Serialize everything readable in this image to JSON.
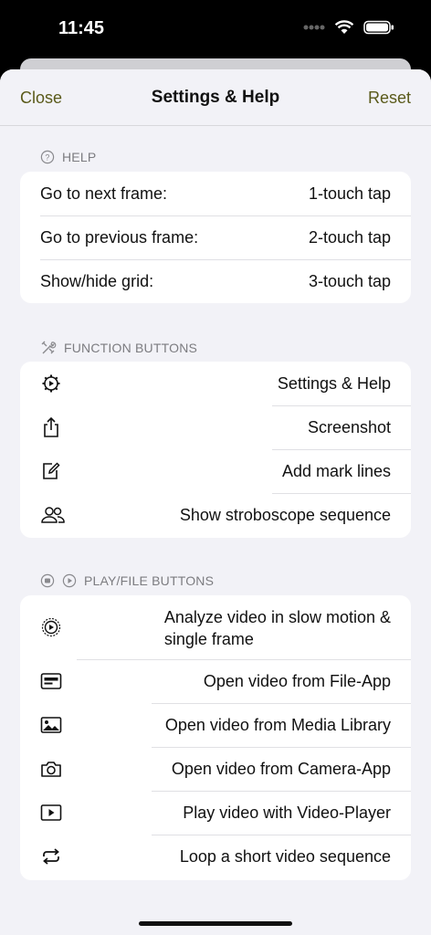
{
  "status": {
    "time": "11:45"
  },
  "nav": {
    "close": "Close",
    "title": "Settings & Help",
    "reset": "Reset"
  },
  "help": {
    "header": "HELP",
    "rows": [
      {
        "action": "Go to next frame:",
        "gesture": "1-touch tap"
      },
      {
        "action": "Go to previous frame:",
        "gesture": "2-touch tap"
      },
      {
        "action": "Show/hide grid:",
        "gesture": "3-touch tap"
      }
    ]
  },
  "function_buttons": {
    "header": "FUNCTION BUTTONS",
    "rows": [
      {
        "icon": "settings-gear-icon",
        "label": "Settings & Help"
      },
      {
        "icon": "share-icon",
        "label": "Screenshot"
      },
      {
        "icon": "edit-icon",
        "label": "Add mark lines"
      },
      {
        "icon": "people-icon",
        "label": "Show stroboscope sequence"
      }
    ]
  },
  "play_file_buttons": {
    "header": "PLAY/FILE BUTTONS",
    "rows": [
      {
        "icon": "play-circle-icon",
        "label_line1": "Analyze video in slow motion &",
        "label_line2": "single frame"
      },
      {
        "icon": "file-card-icon",
        "label": "Open video from File-App"
      },
      {
        "icon": "photo-icon",
        "label": "Open video from Media Library"
      },
      {
        "icon": "camera-icon",
        "label": "Open video from Camera-App"
      },
      {
        "icon": "video-player-icon",
        "label": "Play video with Video-Player"
      },
      {
        "icon": "loop-icon",
        "label": "Loop a short video sequence"
      }
    ]
  }
}
